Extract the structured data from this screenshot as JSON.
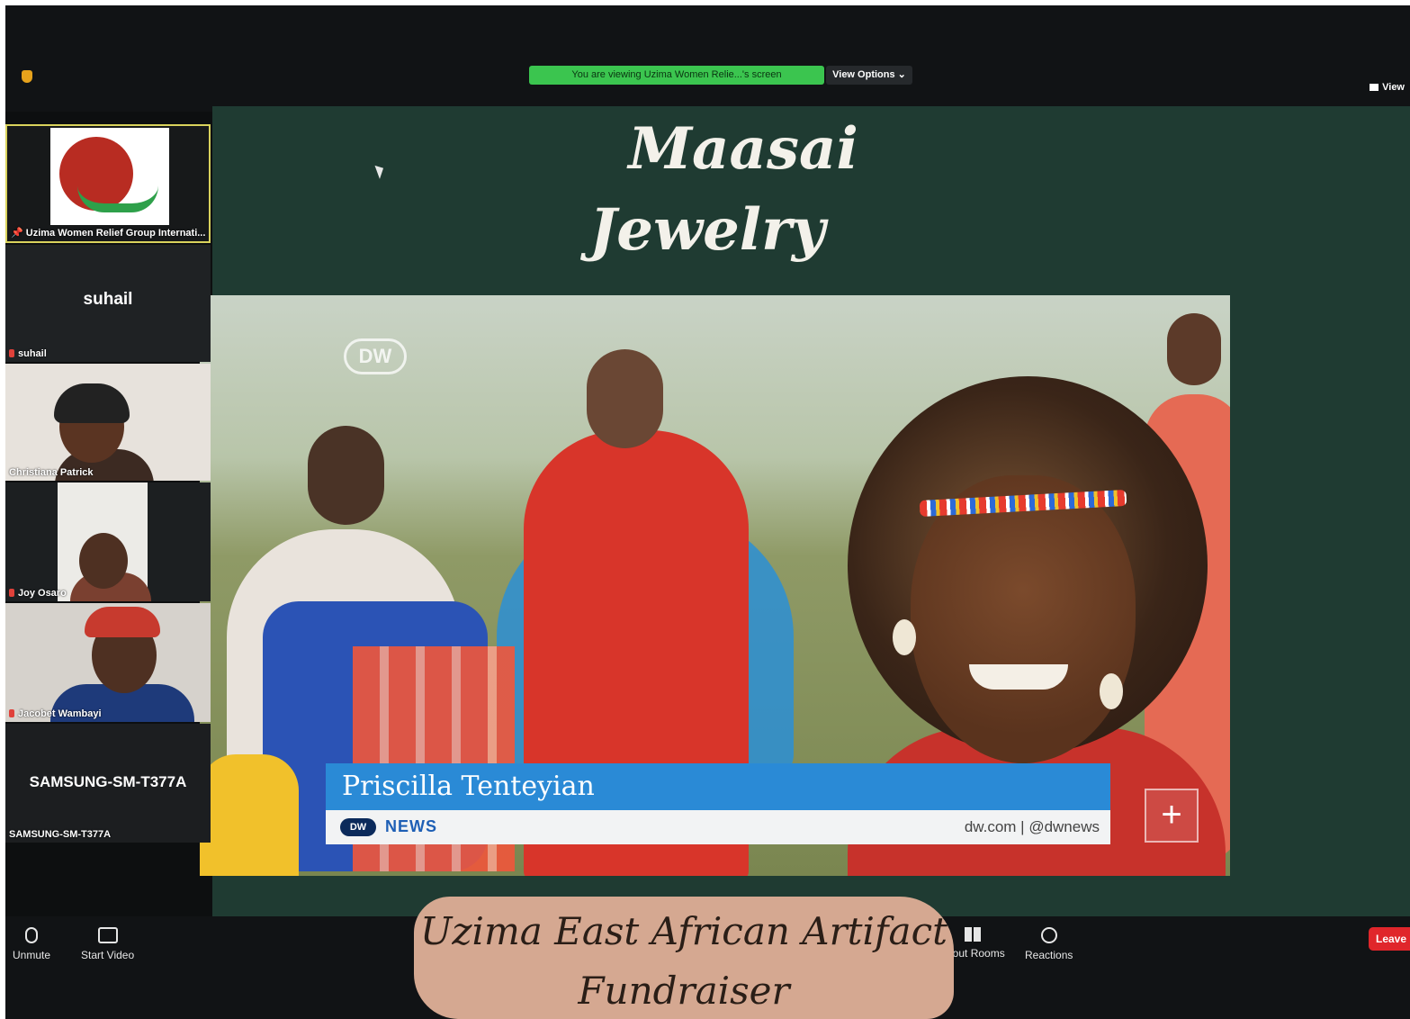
{
  "app": {
    "sharing_banner": "You are viewing Uzima Women Relie...'s screen",
    "view_options": "View Options ⌄",
    "view_button": "View"
  },
  "slide": {
    "title_line1": "Maasai",
    "title_line2": "Jewelry"
  },
  "video": {
    "watermark": "DW",
    "lower_third_name": "Priscilla Tenteyian",
    "lower_third_logo": "DW",
    "lower_third_brand": "NEWS",
    "lower_third_handles": "dw.com  |  @dwnews",
    "plus_symbol": "+"
  },
  "participants": [
    {
      "name": "Uzima Women Relief Group Internati...",
      "pinned": true
    },
    {
      "name": "suhail",
      "display_name": "suhail",
      "muted": true
    },
    {
      "name": "Christiana Patrick"
    },
    {
      "name": "Joy Osaro",
      "muted": true
    },
    {
      "name": "Jacobet Wambayi",
      "muted": true
    },
    {
      "name": "SAMSUNG-SM-T377A",
      "display_name": "SAMSUNG-SM-T377A"
    }
  ],
  "toolbar": {
    "unmute": "Unmute",
    "start_video": "Start Video",
    "breakout_rooms": "akout Rooms",
    "reactions": "Reactions",
    "leave": "Leave"
  },
  "caption": {
    "line1": "Uzima East African Artifact",
    "line2": "Fundraiser"
  },
  "colors": {
    "slide_background": "#1f3b32",
    "sharing_banner": "#3bc54f",
    "lower_third_blue": "#2a8ad6",
    "leave_red": "#e0262b",
    "caption_background": "#d5a891"
  }
}
